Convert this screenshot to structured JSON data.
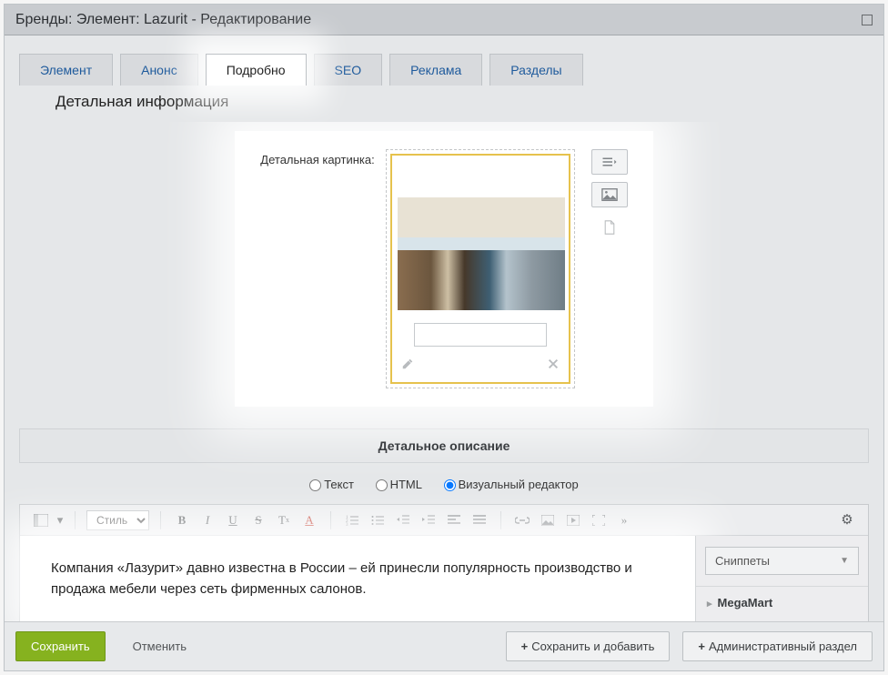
{
  "window_title": "Бренды: Элемент: Lazurit - Редактирование",
  "tabs": {
    "element": "Элемент",
    "anons": "Анонс",
    "detail": "Подробно",
    "seo": "SEO",
    "ads": "Реклама",
    "sections": "Разделы"
  },
  "section_title": "Детальная информация",
  "image": {
    "label": "Детальная картинка:",
    "caption": ""
  },
  "description_header": "Детальное описание",
  "radios": {
    "text": "Текст",
    "html": "HTML",
    "visual": "Визуальный редактор"
  },
  "style_select": "Стиль",
  "editor_text": "Компания «Лазурит» давно известна в России – ей принесли популярность производство и продажа мебели через сеть фирменных салонов.",
  "snippets_btn": "Сниппеты",
  "snippets_item": "MegaMart",
  "footer": {
    "save": "Сохранить",
    "cancel": "Отменить",
    "save_add": "Сохранить и добавить",
    "admin": "Административный раздел"
  }
}
